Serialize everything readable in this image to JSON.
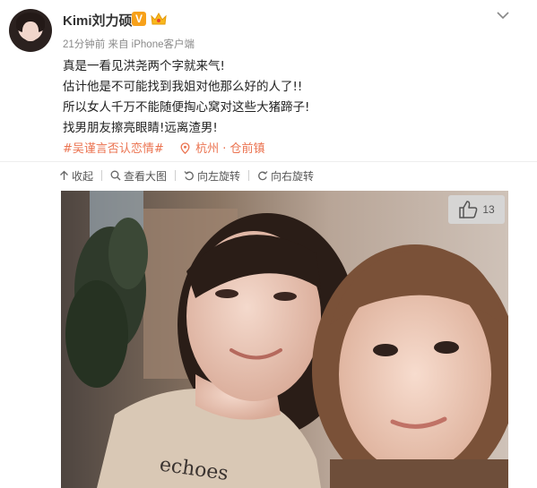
{
  "post": {
    "username": "Kimi刘力硕",
    "verified_badge": "V",
    "meta": "21分钟前 来自 iPhone客户端",
    "content_lines": [
      "真是一看见洪尧两个字就来气!",
      "估计他是不可能找到我姐对他那么好的人了!!",
      "所以女人千万不能随便掏心窝对这些大猪蹄子!",
      "找男朋友擦亮眼睛!远离渣男!"
    ],
    "hashtag": "#吴谨言否认恋情#",
    "location": "杭州 · 仓前镇"
  },
  "toolbar": {
    "collapse": "收起",
    "view_large": "查看大图",
    "rotate_left": "向左旋转",
    "rotate_right": "向右旋转"
  },
  "photo": {
    "like_count": "13",
    "shirt_text": "echoes"
  },
  "colors": {
    "accent_link": "#eb7350",
    "meta_gray": "#8a8a8a",
    "badge_orange": "#f7a11a"
  },
  "icons": [
    "chevron-down-icon",
    "verified-icon",
    "crown-icon",
    "location-pin-icon",
    "arrow-up-icon",
    "search-icon",
    "rotate-left-icon",
    "rotate-right-icon",
    "thumbs-up-icon"
  ]
}
